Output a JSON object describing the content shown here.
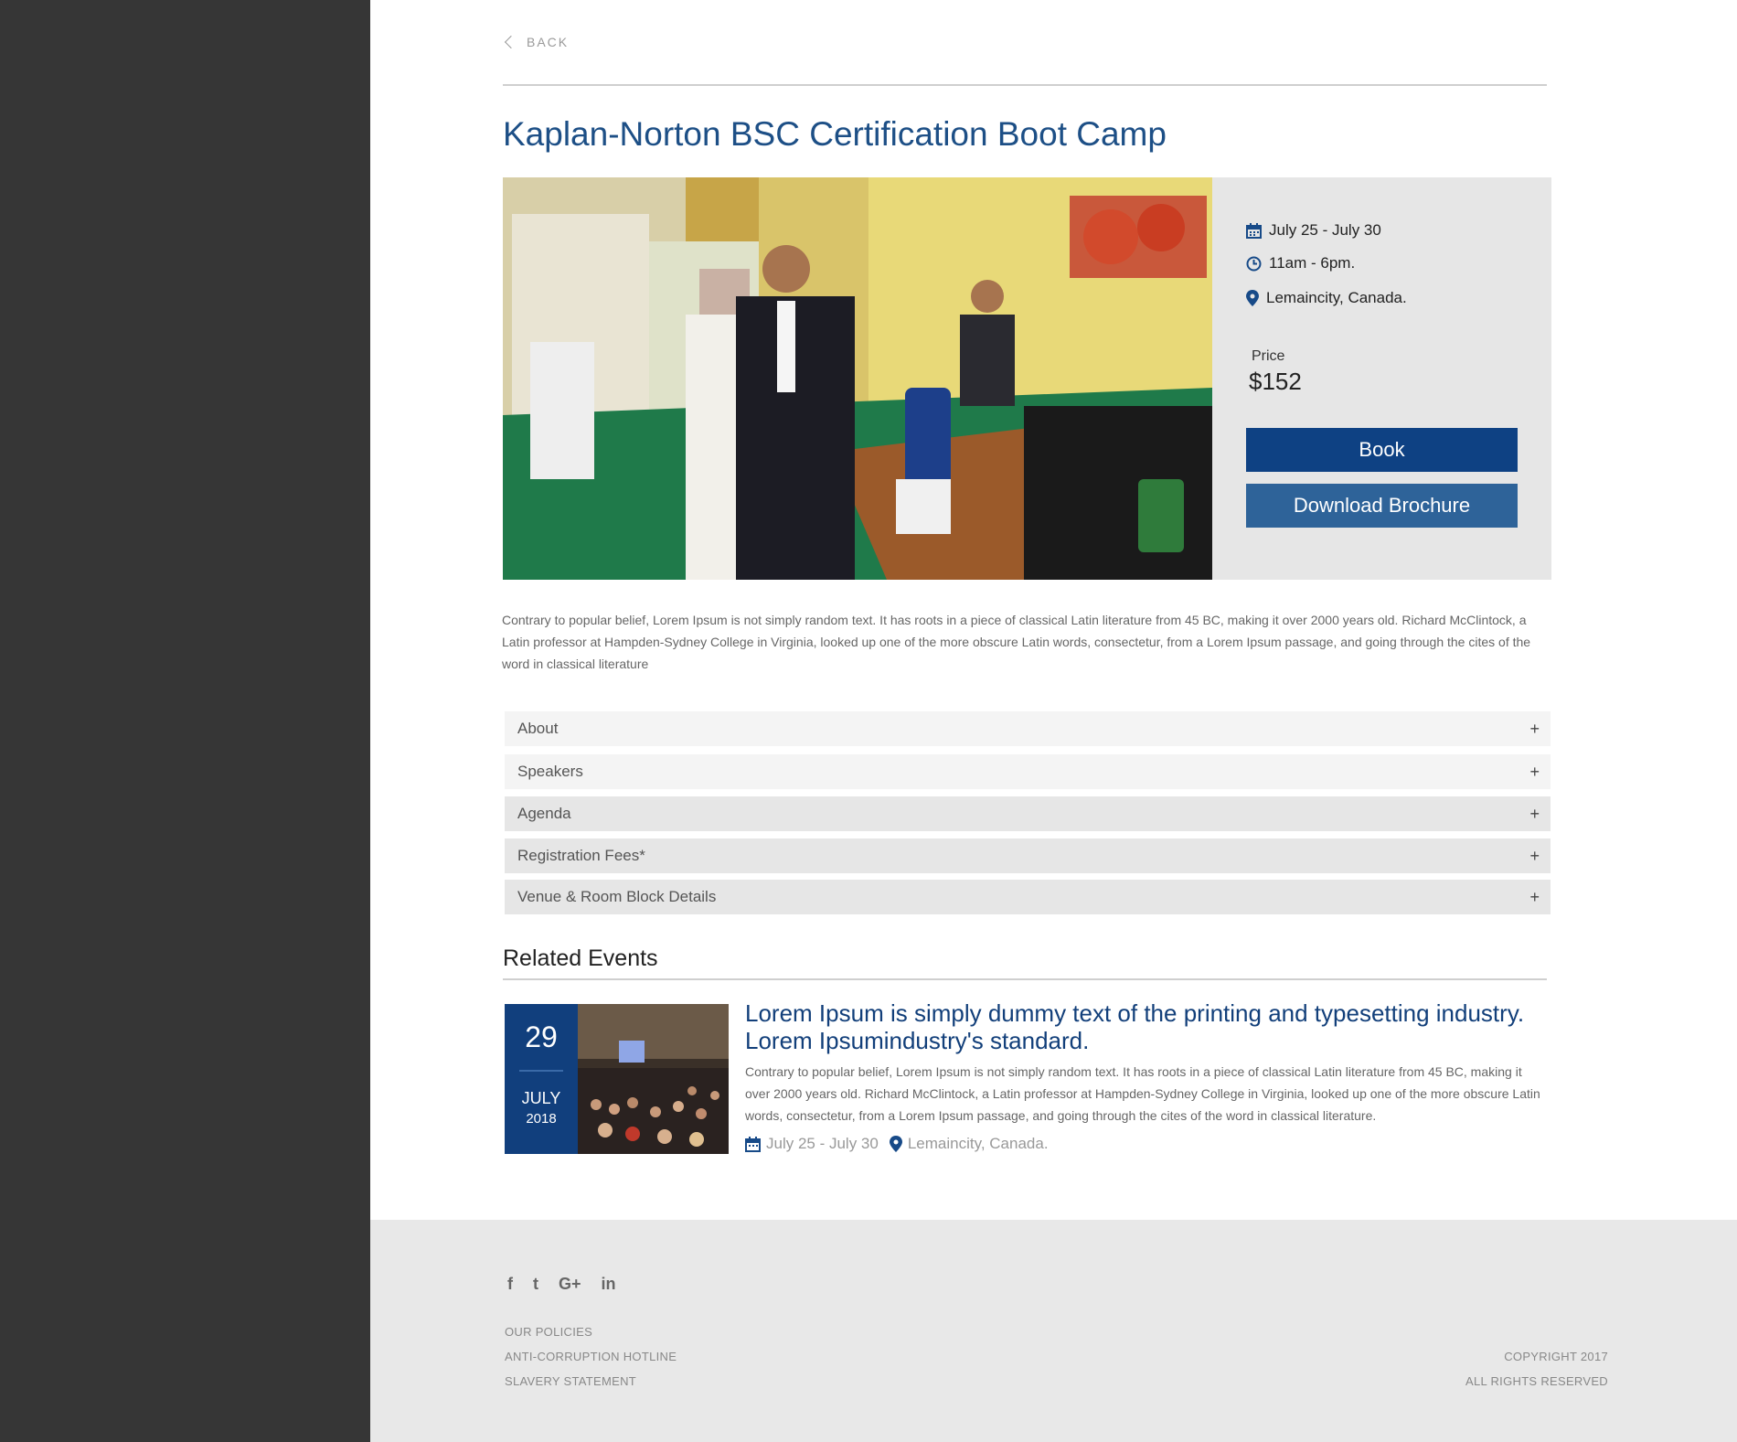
{
  "nav": {
    "back_label": "BACK"
  },
  "event": {
    "title": "Kaplan-Norton BSC Certification Boot Camp",
    "date": "July 25 - July 30",
    "time": "11am - 6pm.",
    "location": "Lemaincity, Canada.",
    "price_label": "Price",
    "price": "$152",
    "book_label": "Book",
    "brochure_label": "Download Brochure",
    "description": "Contrary to popular belief, Lorem Ipsum is not simply random text. It has roots in a piece of classical Latin literature from 45 BC, making it over 2000 years old. Richard McClintock, a Latin professor at Hampden-Sydney College in Virginia, looked up one of the more obscure Latin words, consectetur, from a Lorem Ipsum passage, and going through the cites of the word in classical literature"
  },
  "accordion": [
    {
      "label": "About",
      "icon": "+"
    },
    {
      "label": "Speakers",
      "icon": "+"
    },
    {
      "label": "Agenda",
      "icon": "+"
    },
    {
      "label": "Registration Fees*",
      "icon": "+"
    },
    {
      "label": "Venue & Room Block Details",
      "icon": "+"
    }
  ],
  "related": {
    "heading": "Related Events",
    "items": [
      {
        "day": "29",
        "month": "JULY",
        "year": "2018",
        "title": "Lorem Ipsum is simply dummy text of the printing and typesetting industry. Lorem Ipsumindustry's standard.",
        "description": "Contrary to popular belief, Lorem Ipsum is not simply random text. It has roots in a piece of classical Latin literature from 45 BC, making it over 2000 years old. Richard McClintock, a Latin professor at Hampden-Sydney College in Virginia, looked up one of the more obscure Latin words, consectetur, from a Lorem Ipsum passage, and going through the cites of the word in classical literature.",
        "date": "July 25 - July 30",
        "location": "Lemaincity, Canada."
      }
    ]
  },
  "footer": {
    "social": [
      {
        "icon": "facebook-icon",
        "glyph": "f"
      },
      {
        "icon": "twitter-icon",
        "glyph": "t"
      },
      {
        "icon": "google-plus-icon",
        "glyph": "G+"
      },
      {
        "icon": "linkedin-icon",
        "glyph": "in"
      }
    ],
    "links": [
      "OUR POLICIES",
      "ANTI-CORRUPTION HOTLINE",
      "SLAVERY STATEMENT"
    ],
    "copyright": "COPYRIGHT 2017",
    "rights": "ALL RIGHTS RESERVED"
  },
  "colors": {
    "sidebar": "#363636",
    "brand_blue": "#0e4183",
    "secondary_blue": "#2e6399",
    "title_blue": "#1d4f86",
    "info_panel": "#e6e6e6",
    "footer_bg": "#e8e8e8"
  }
}
